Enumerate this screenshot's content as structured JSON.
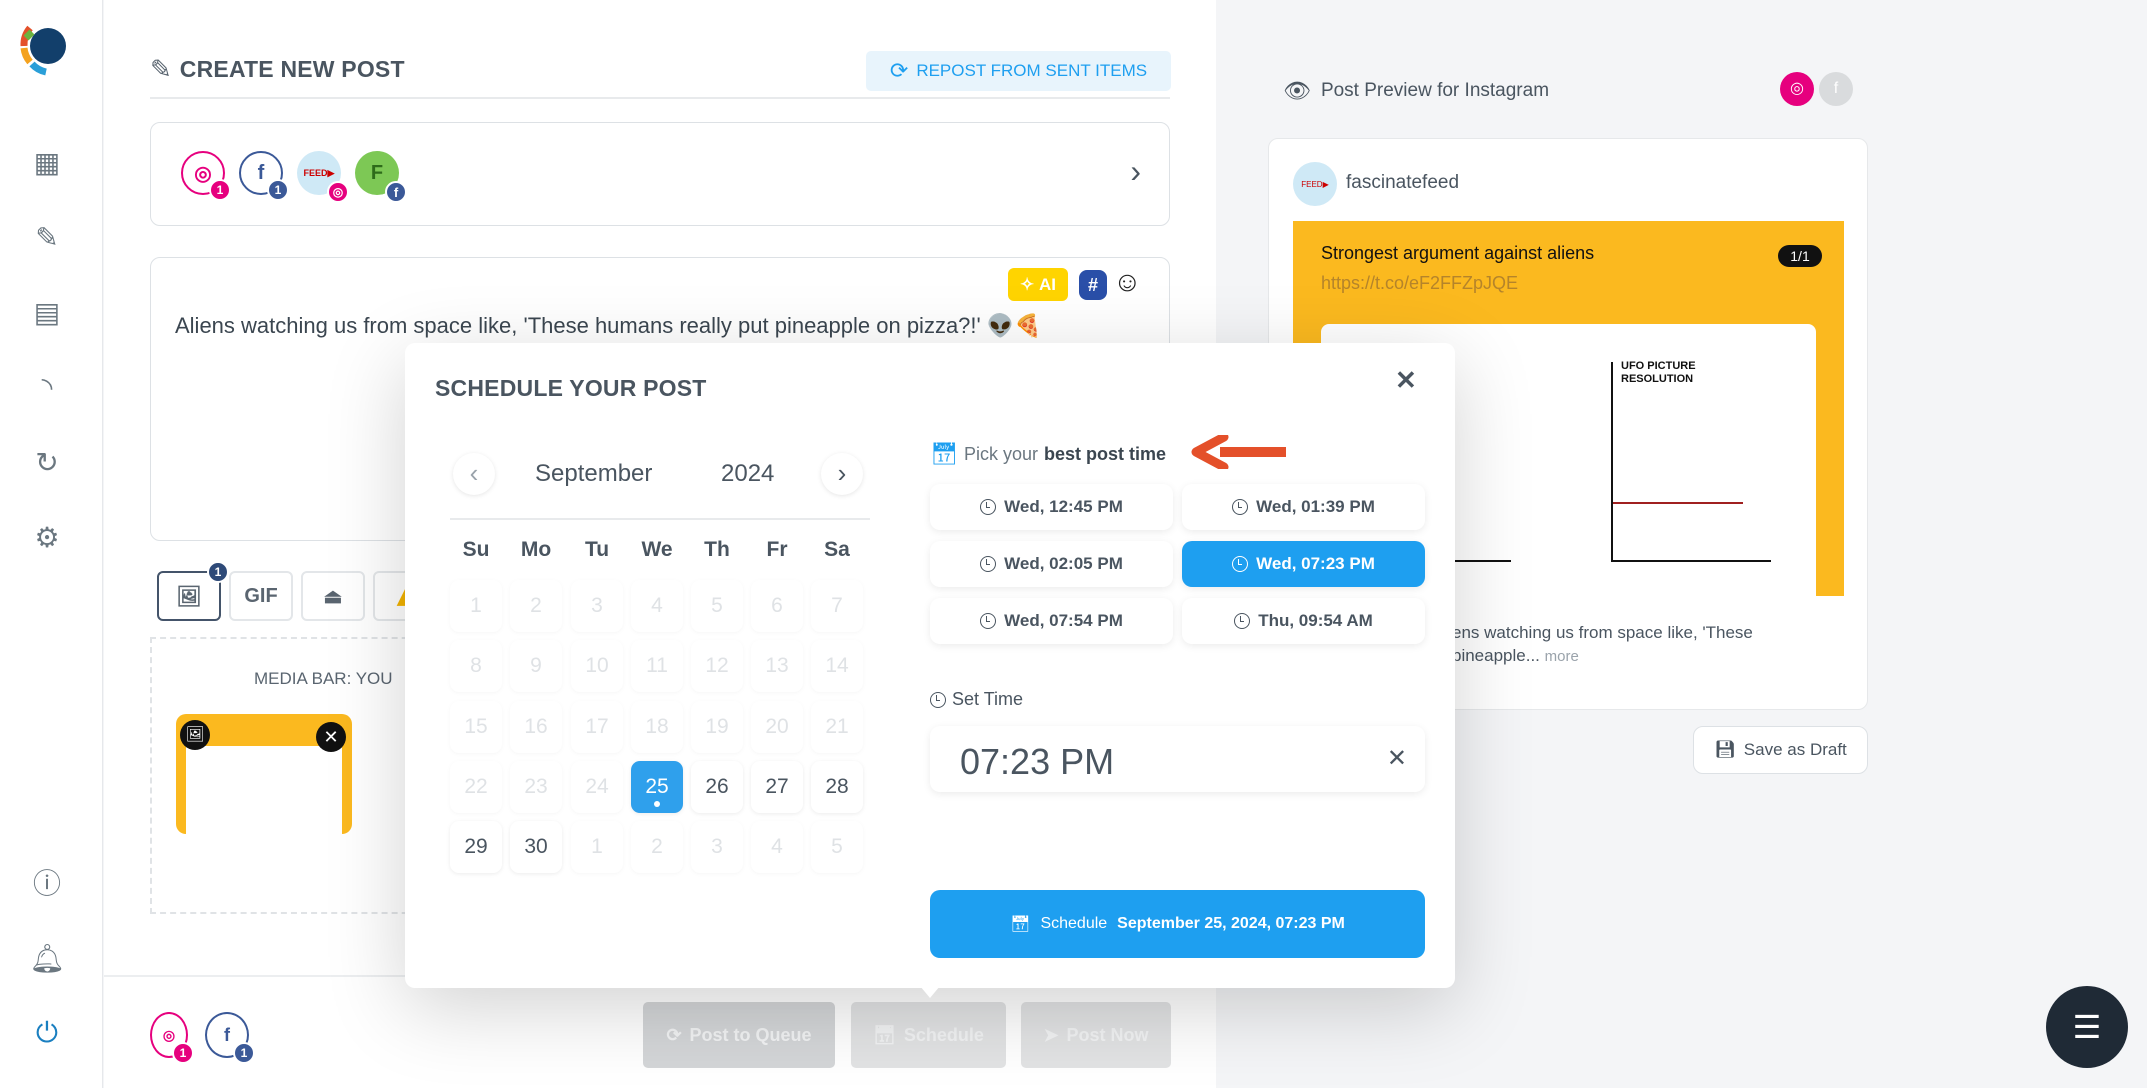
{
  "sidebar": {
    "icons": [
      "dashboard-icon",
      "edit-icon",
      "news-icon",
      "rss-icon",
      "history-icon",
      "gear-icon",
      "info-icon",
      "bell-icon",
      "power-icon"
    ]
  },
  "create": {
    "title": "CREATE NEW POST",
    "repost_label": "REPOST FROM SENT ITEMS",
    "accounts": [
      {
        "type": "instagram",
        "count": "1"
      },
      {
        "type": "facebook",
        "count": "1"
      },
      {
        "type": "fascinatefeed-instagram"
      },
      {
        "type": "F-facebook",
        "letter": "F"
      }
    ],
    "ai_label": "AI",
    "hashtag": "#",
    "post_text": "Aliens watching us from space like, 'These humans really put pineapple on pizza?!' 👽🍕",
    "media_count": "1",
    "gif_label": "GIF",
    "media_bar_text": "MEDIA BAR: YOU"
  },
  "bottom": {
    "ig_count": "1",
    "fb_count": "1",
    "queue_label": "Post to Queue",
    "schedule_label": "Schedule",
    "post_now_label": "Post Now"
  },
  "modal": {
    "title": "SCHEDULE YOUR POST",
    "month": "September",
    "year": "2024",
    "weekdays": [
      "Su",
      "Mo",
      "Tu",
      "We",
      "Th",
      "Fr",
      "Sa"
    ],
    "weeks": [
      [
        [
          "1",
          "dis"
        ],
        [
          "2",
          "dis"
        ],
        [
          "3",
          "dis"
        ],
        [
          "4",
          "dis"
        ],
        [
          "5",
          "dis"
        ],
        [
          "6",
          "dis"
        ],
        [
          "7",
          "dis"
        ]
      ],
      [
        [
          "8",
          "dis"
        ],
        [
          "9",
          "dis"
        ],
        [
          "10",
          "dis"
        ],
        [
          "11",
          "dis"
        ],
        [
          "12",
          "dis"
        ],
        [
          "13",
          "dis"
        ],
        [
          "14",
          "dis"
        ]
      ],
      [
        [
          "15",
          "dis"
        ],
        [
          "16",
          "dis"
        ],
        [
          "17",
          "dis"
        ],
        [
          "18",
          "dis"
        ],
        [
          "19",
          "dis"
        ],
        [
          "20",
          "dis"
        ],
        [
          "21",
          "dis"
        ]
      ],
      [
        [
          "22",
          "dis"
        ],
        [
          "23",
          "dis"
        ],
        [
          "24",
          "dis"
        ],
        [
          "25",
          "sel"
        ],
        [
          "26",
          ""
        ],
        [
          "27",
          ""
        ],
        [
          "28",
          ""
        ]
      ],
      [
        [
          "29",
          ""
        ],
        [
          "30",
          ""
        ],
        [
          "1",
          "dis"
        ],
        [
          "2",
          "dis"
        ],
        [
          "3",
          "dis"
        ],
        [
          "4",
          "dis"
        ],
        [
          "5",
          "dis"
        ]
      ]
    ],
    "pick_prefix": "Pick your",
    "pick_bold": "best post time",
    "slots": [
      {
        "label": "Wed, 12:45 PM"
      },
      {
        "label": "Wed, 01:39 PM"
      },
      {
        "label": "Wed, 02:05 PM"
      },
      {
        "label": "Wed, 07:23 PM",
        "selected": true
      },
      {
        "label": "Wed, 07:54 PM"
      },
      {
        "label": "Thu, 09:54 AM"
      }
    ],
    "set_time_label": "Set Time",
    "time_value": "07:23 PM",
    "schedule_label": "Schedule",
    "schedule_date": "September 25, 2024, 07:23 PM"
  },
  "preview": {
    "title": "Post Preview for Instagram",
    "account": "fascinatefeed",
    "image_title": "Strongest argument against aliens",
    "image_link": "https://t.co/eF2FFZpJQE",
    "counter": "1/1",
    "chart_title_1": "UFO PICTURE",
    "chart_title_2": "RESOLUTION",
    "caption_1": "ens watching us from space like, 'These",
    "caption_2": "pineapple...",
    "more": "more",
    "save_draft": "Save as Draft"
  },
  "colors": {
    "accent": "#1e9ff0",
    "instagram": "#e6007e",
    "facebook": "#3b5998",
    "arrow": "#e4502a",
    "image_bg": "#fbb91f"
  }
}
